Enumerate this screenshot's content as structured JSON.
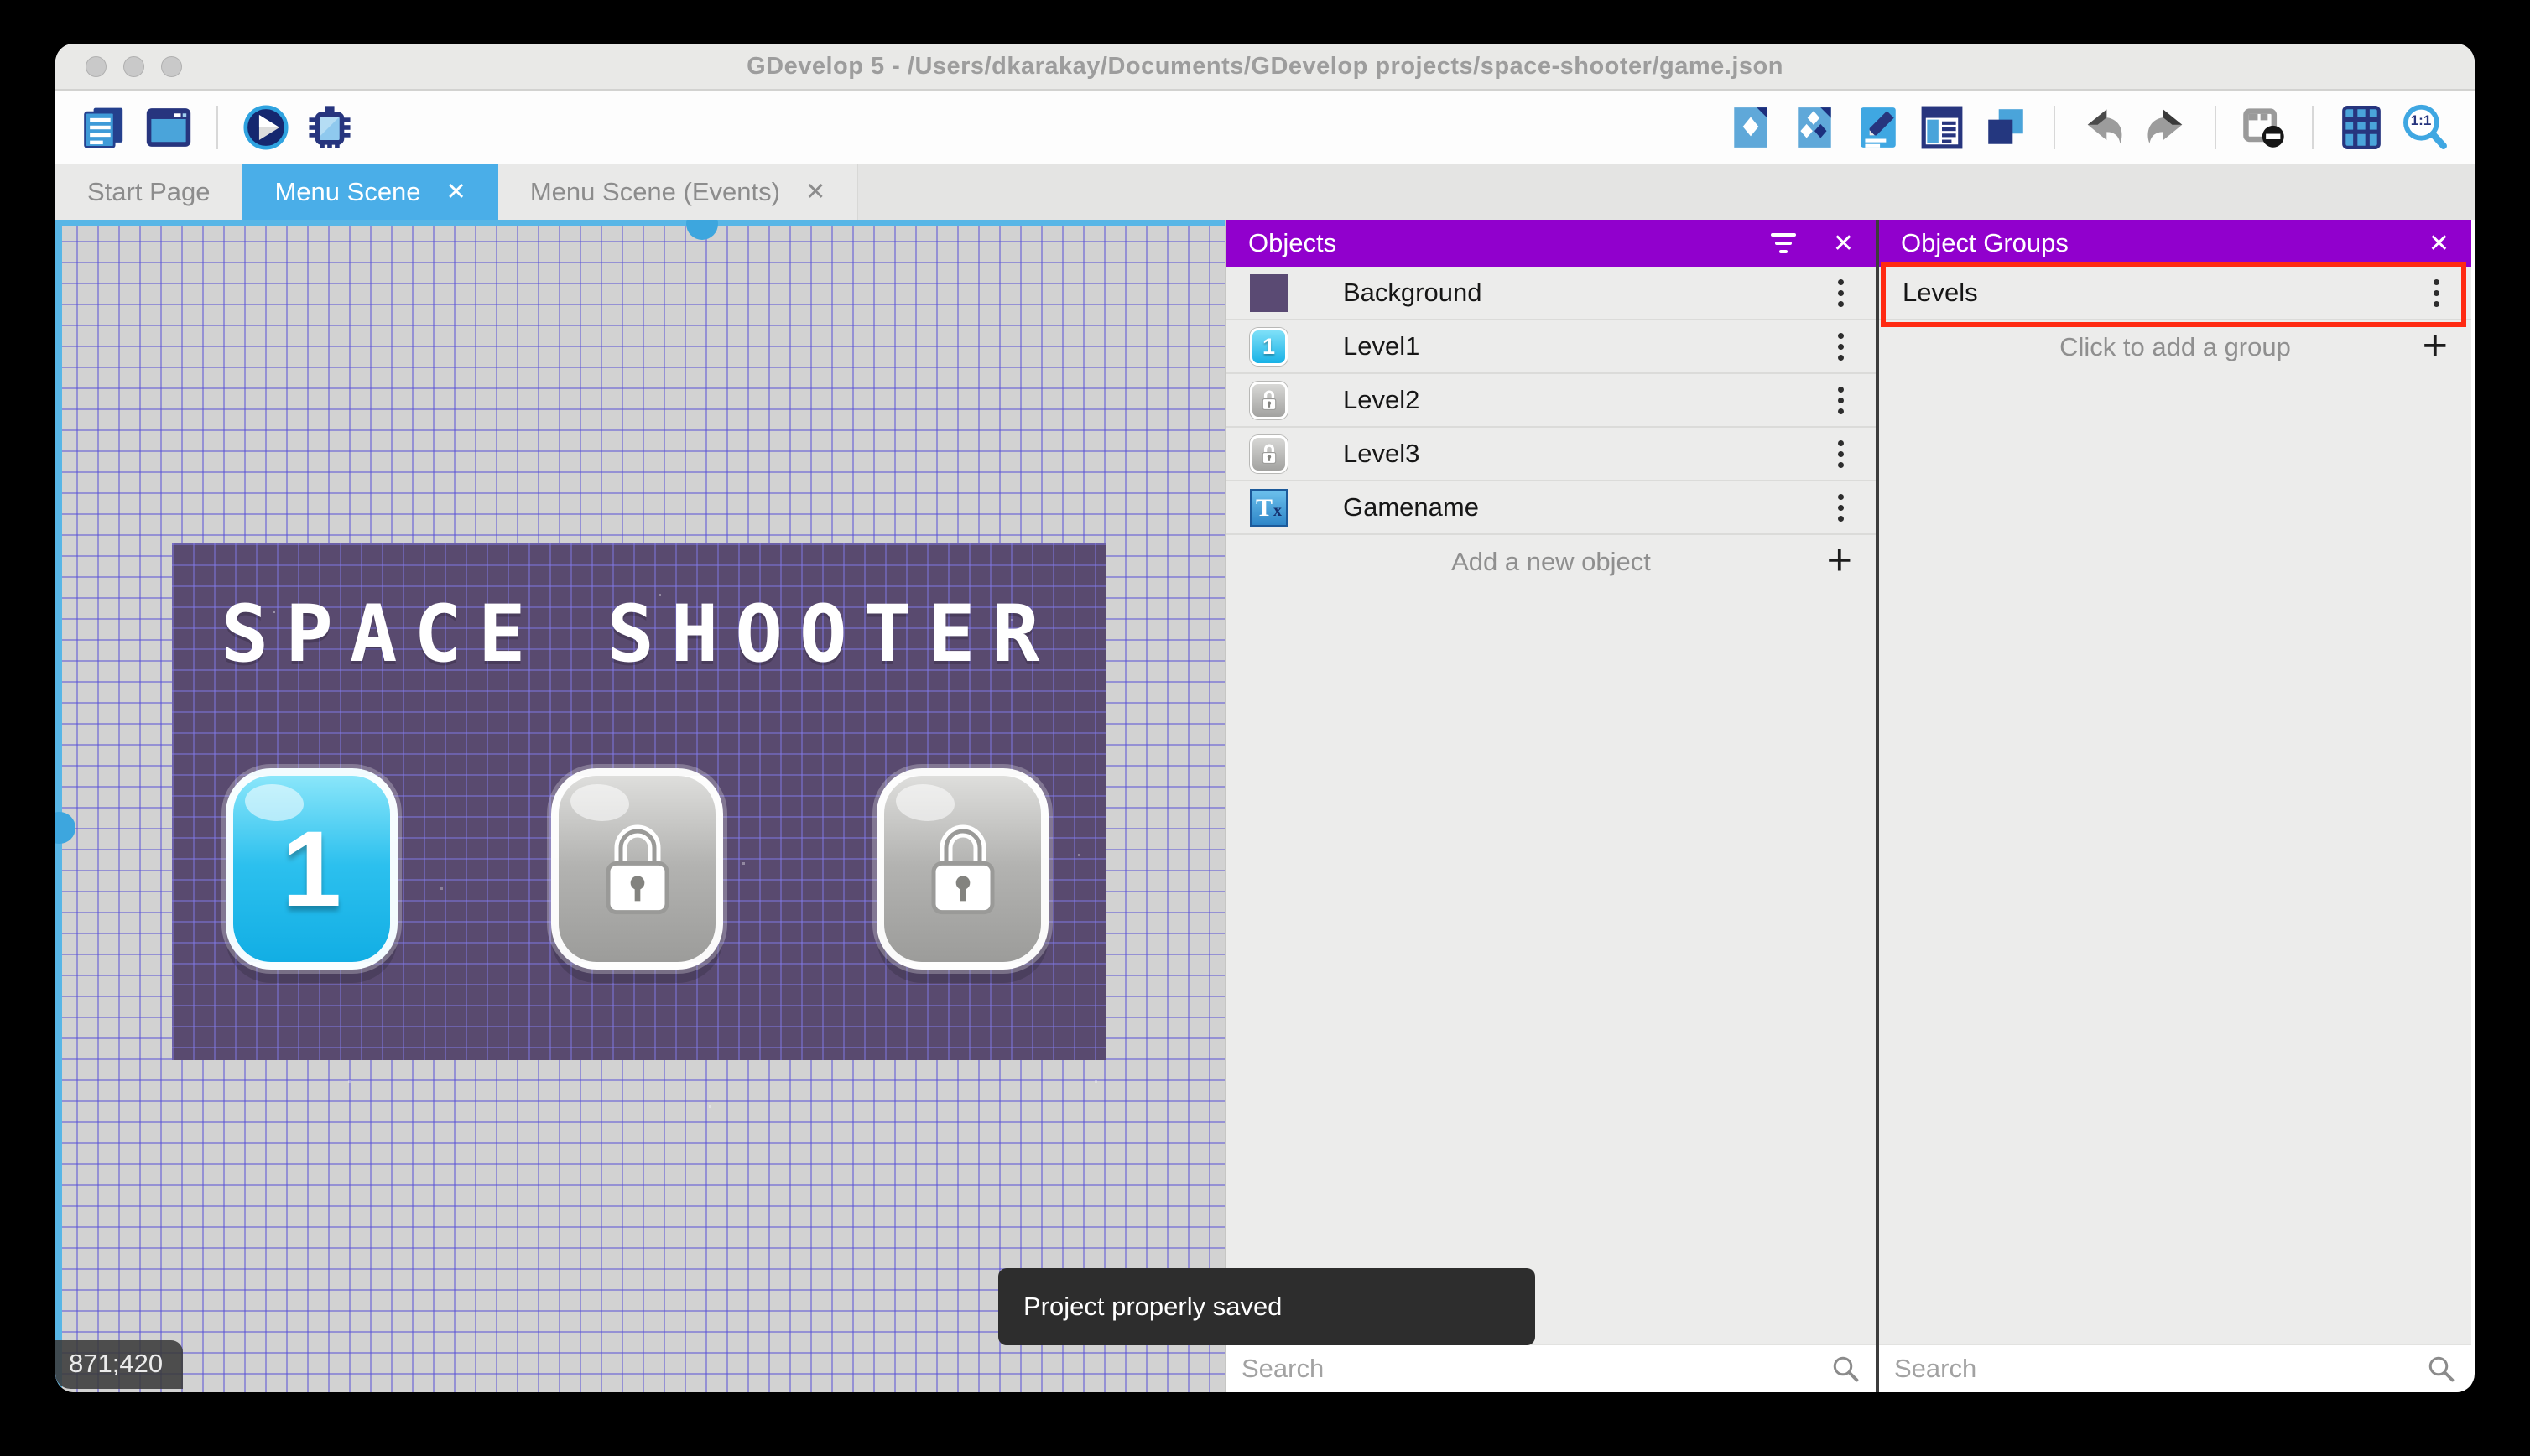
{
  "window": {
    "title": "GDevelop 5 - /Users/dkarakay/Documents/GDevelop projects/space-shooter/game.json"
  },
  "toolbar": {
    "zoom_label": "1:1",
    "left_icons": [
      "project-manager",
      "scene-window",
      "play-preview",
      "debug"
    ],
    "right_icons": [
      "objects-editor",
      "object-groups-editor",
      "properties",
      "instances-list",
      "layers",
      "undo",
      "redo",
      "render-options",
      "grid",
      "zoom-1-1"
    ]
  },
  "tabs": [
    {
      "label": "Start Page"
    },
    {
      "label": "Menu Scene"
    },
    {
      "label": "Menu Scene (Events)"
    }
  ],
  "glyphs": {
    "close": "✕",
    "plus": "+"
  },
  "canvas": {
    "scene_title": "SPACE SHOOTER",
    "level_buttons": [
      {
        "label": "1",
        "state": "unlocked"
      },
      {
        "label": "",
        "state": "locked"
      },
      {
        "label": "",
        "state": "locked"
      }
    ],
    "cursor_coordinates": "871;420"
  },
  "objects_panel": {
    "title": "Objects",
    "rows": [
      {
        "label": "Background",
        "thumb": "background-swatch"
      },
      {
        "label": "Level1",
        "thumb": "button-unlocked",
        "thumb_label": "1"
      },
      {
        "label": "Level2",
        "thumb": "button-locked"
      },
      {
        "label": "Level3",
        "thumb": "button-locked"
      },
      {
        "label": "Gamename",
        "thumb": "text-object",
        "thumb_main": "T",
        "thumb_sub": "x"
      }
    ],
    "add_label": "Add a new object",
    "search_placeholder": "Search"
  },
  "groups_panel": {
    "title": "Object Groups",
    "rows": [
      {
        "label": "Levels"
      }
    ],
    "add_label": "Click to add a group",
    "search_placeholder": "Search"
  },
  "toast": {
    "message": "Project properly saved"
  },
  "colors": {
    "panel_header": "#9100cd",
    "active_tab": "#4aaee8",
    "selection": "#58b6e6",
    "annotation": "#ff2a12",
    "scene_background": "#594a6f"
  }
}
